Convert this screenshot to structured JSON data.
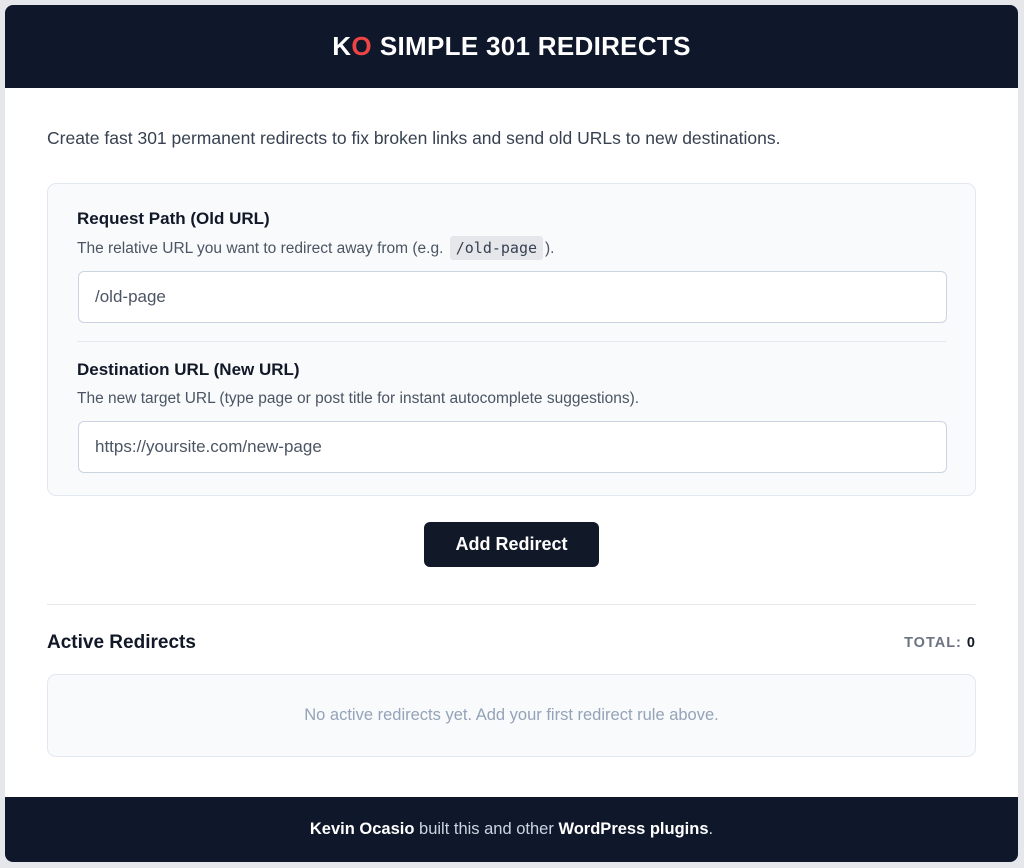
{
  "header": {
    "brand_k": "K",
    "brand_o": "O",
    "title": "SIMPLE 301 REDIRECTS"
  },
  "intro": "Create fast 301 permanent redirects to fix broken links and send old URLs to new destinations.",
  "form": {
    "request": {
      "label": "Request Path (Old URL)",
      "help_before": "The relative URL you want to redirect away from (e.g.",
      "help_code": "/old-page",
      "help_after": ").",
      "placeholder": "/old-page"
    },
    "destination": {
      "label": "Destination URL (New URL)",
      "help": "The new target URL (type page or post title for instant autocomplete suggestions).",
      "placeholder": "https://yoursite.com/new-page"
    },
    "submit_label": "Add Redirect"
  },
  "active": {
    "title": "Active Redirects",
    "total_label": "TOTAL:",
    "total_value": "0",
    "empty_message": "No active redirects yet. Add your first redirect rule above."
  },
  "footer": {
    "author": "Kevin Ocasio",
    "middle": " built this and other ",
    "link": "WordPress plugins",
    "end": "."
  },
  "colors": {
    "header_bg": "#0f172a",
    "accent_red": "#ef4444",
    "button_bg": "#111827"
  }
}
